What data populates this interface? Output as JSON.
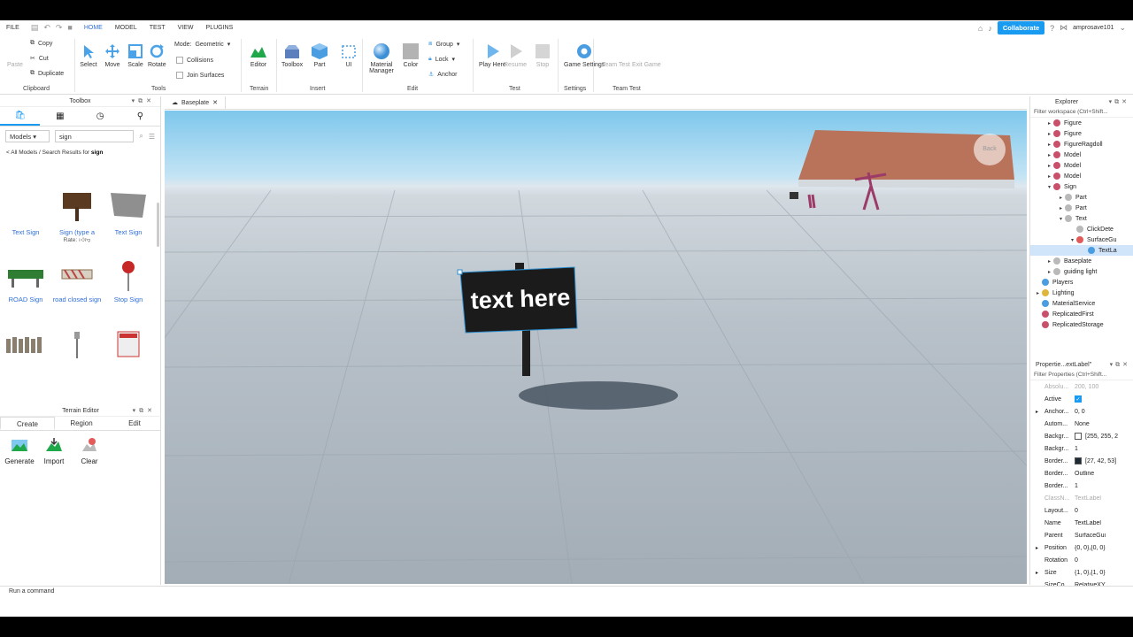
{
  "menu": {
    "file": "FILE",
    "tabs": [
      "HOME",
      "MODEL",
      "TEST",
      "VIEW",
      "PLUGINS"
    ],
    "active_tab": "HOME",
    "collaborate": "Collaborate",
    "username": "amprosave101"
  },
  "ribbon": {
    "clipboard": {
      "paste": "Paste",
      "copy": "Copy",
      "cut": "Cut",
      "duplicate": "Duplicate",
      "group": "Clipboard"
    },
    "tools": {
      "select": "Select",
      "move": "Move",
      "scale": "Scale",
      "rotate": "Rotate",
      "group": "Tools",
      "mode_label": "Mode:",
      "mode_value": "Geometric",
      "collisions": "Collisions",
      "join_surfaces": "Join Surfaces"
    },
    "terrain": {
      "editor": "Editor",
      "group": "Terrain"
    },
    "insert": {
      "toolbox": "Toolbox",
      "part": "Part",
      "ui": "UI",
      "group": "Insert"
    },
    "edit": {
      "material_manager": "Material Manager",
      "color": "Color",
      "group_btn": "Group",
      "lock": "Lock",
      "anchor": "Anchor",
      "group": "Edit"
    },
    "test": {
      "play_here": "Play Here",
      "resume": "Resume",
      "stop": "Stop",
      "group": "Test"
    },
    "settings": {
      "game_settings": "Game Settings",
      "group": "Settings"
    },
    "team_test": {
      "team_test": "Team Test",
      "exit_game": "Exit Game",
      "group": "Team Test"
    },
    "colors": {
      "accent": "#1a9bf2",
      "terrain_green": "#1fa84a",
      "part_blue": "#4a9de0"
    }
  },
  "toolbox": {
    "title": "Toolbox",
    "category": "Models",
    "search_value": "sign",
    "breadcrumb_prefix": "< All Models / Search Results for ",
    "breadcrumb_term": "sign",
    "rate_label": "Rate:",
    "items": [
      {
        "label": "Text Sign"
      },
      {
        "label": "Sign (type a"
      },
      {
        "label": "Text Sign"
      },
      {
        "label": "ROAD Sign"
      },
      {
        "label": "road closed sign"
      },
      {
        "label": "Stop Sign"
      }
    ]
  },
  "terrain_editor": {
    "title": "Terrain Editor",
    "tabs": [
      "Create",
      "Region",
      "Edit"
    ],
    "active_tab": "Create",
    "tools": [
      "Generate",
      "Import",
      "Clear"
    ]
  },
  "document": {
    "tab_label": "Baseplate"
  },
  "viewport": {
    "sign_text": "text here",
    "back_label": "Back"
  },
  "explorer": {
    "title": "Explorer",
    "filter_placeholder": "Filter workspace (Ctrl+Shift...",
    "nodes": [
      {
        "label": "Figure",
        "level": 2,
        "arrow": "▸"
      },
      {
        "label": "Figure",
        "level": 2,
        "arrow": "▸"
      },
      {
        "label": "FigureRagdoll",
        "level": 2,
        "arrow": "▸"
      },
      {
        "label": "Model",
        "level": 2,
        "arrow": "▸"
      },
      {
        "label": "Model",
        "level": 2,
        "arrow": "▸"
      },
      {
        "label": "Model",
        "level": 2,
        "arrow": "▸"
      },
      {
        "label": "Sign",
        "level": 2,
        "arrow": "▾"
      },
      {
        "label": "Part",
        "level": 3,
        "arrow": "▸"
      },
      {
        "label": "Part",
        "level": 3,
        "arrow": "▸"
      },
      {
        "label": "Text",
        "level": 3,
        "arrow": "▾"
      },
      {
        "label": "ClickDete",
        "level": 4,
        "arrow": ""
      },
      {
        "label": "SurfaceGu",
        "level": 4,
        "arrow": "▾"
      },
      {
        "label": "TextLa",
        "level": 5,
        "arrow": ""
      },
      {
        "label": "Baseplate",
        "level": 2,
        "arrow": "▸"
      },
      {
        "label": "guiding light",
        "level": 2,
        "arrow": "▸"
      },
      {
        "label": "Players",
        "level": 1,
        "arrow": ""
      },
      {
        "label": "Lighting",
        "level": 1,
        "arrow": "▸"
      },
      {
        "label": "MaterialService",
        "level": 1,
        "arrow": ""
      },
      {
        "label": "ReplicatedFirst",
        "level": 1,
        "arrow": ""
      },
      {
        "label": "ReplicatedStorage",
        "level": 1,
        "arrow": ""
      }
    ]
  },
  "properties": {
    "title": "Propertie...extLabel\"",
    "filter_placeholder": "Filter Properties (Ctrl+Shift...",
    "rows": [
      {
        "key": "Absolu...",
        "value": "200, 100",
        "dim": true
      },
      {
        "key": "Active",
        "value": "",
        "check": true
      },
      {
        "key": "Anchor...",
        "value": "0, 0",
        "expand": true
      },
      {
        "key": "Autom...",
        "value": "None"
      },
      {
        "key": "Backgr...",
        "value": "[255, 255, 2",
        "swatch": "#ffffff"
      },
      {
        "key": "Backgr...",
        "value": "1"
      },
      {
        "key": "Border...",
        "value": "[27, 42, 53]",
        "swatch": "#1b2a35"
      },
      {
        "key": "Border...",
        "value": "Outline"
      },
      {
        "key": "Border...",
        "value": "1"
      },
      {
        "key": "ClassN...",
        "value": "TextLabel",
        "dim": true
      },
      {
        "key": "Layout...",
        "value": "0"
      },
      {
        "key": "Name",
        "value": "TextLabel"
      },
      {
        "key": "Parent",
        "value": "SurfaceGui"
      },
      {
        "key": "Position",
        "value": "{0, 0},{0, 0}",
        "expand": true
      },
      {
        "key": "Rotation",
        "value": "0"
      },
      {
        "key": "Size",
        "value": "{1, 0},{1, 0}",
        "expand": true
      },
      {
        "key": "SizeCo...",
        "value": "RelativeXY"
      }
    ]
  },
  "command_bar": {
    "placeholder": "Run a command"
  }
}
